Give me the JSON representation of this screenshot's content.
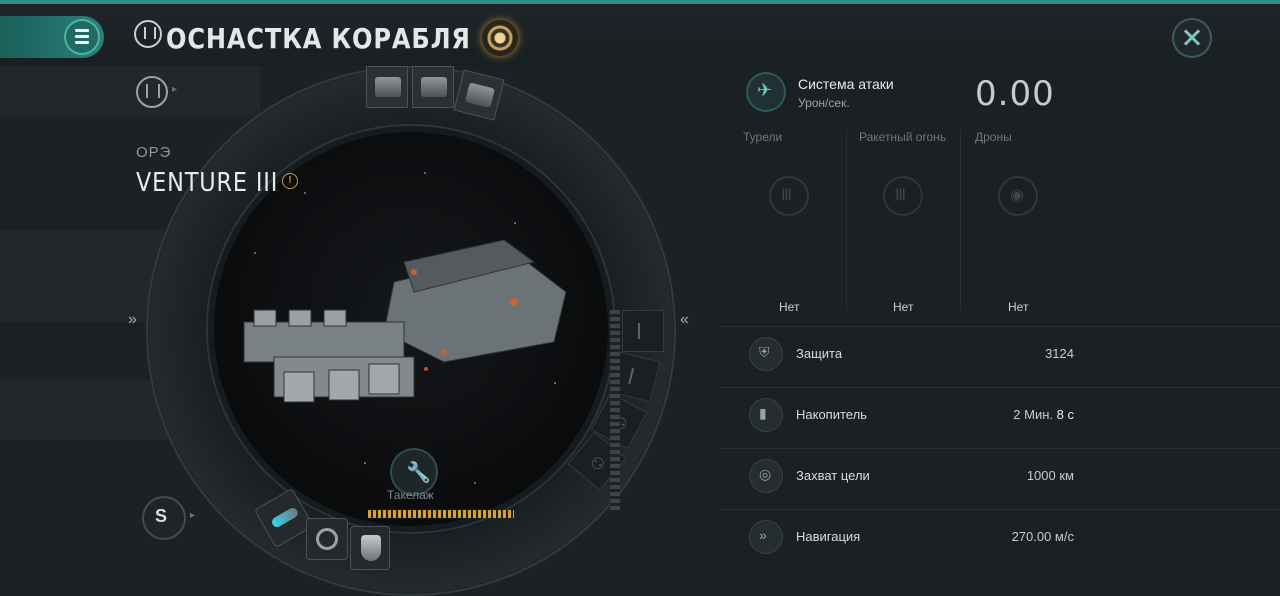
{
  "header": {
    "title": "ОСНАСТКА КОРАБЛЯ"
  },
  "ship": {
    "class": "ОРЭ",
    "name": "VENTURE III",
    "warning": "!"
  },
  "rig": {
    "label": "Такелаж"
  },
  "attack": {
    "title": "Система атаки",
    "subtitle": "Урон/сек.",
    "dps": "0.00",
    "columns": [
      {
        "label": "Турели",
        "value": "Нет"
      },
      {
        "label": "Ракетный огонь",
        "value": "Нет"
      },
      {
        "label": "Дроны",
        "value": "Нет"
      }
    ]
  },
  "stats": [
    {
      "label": "Защита",
      "value": "3124",
      "icon": "shield-icon"
    },
    {
      "label": "Накопитель",
      "value": "2 Мин.",
      "value_hl": "8 с",
      "icon": "battery-icon"
    },
    {
      "label": "Захват цели",
      "value": "1000 км",
      "icon": "target-icon"
    },
    {
      "label": "Навигация",
      "value": "270.00 м/с",
      "icon": "speed-icon"
    }
  ],
  "colors": {
    "accent": "#2f8f86",
    "capacitor": "#d7a230",
    "warning": "#c79a3a"
  }
}
